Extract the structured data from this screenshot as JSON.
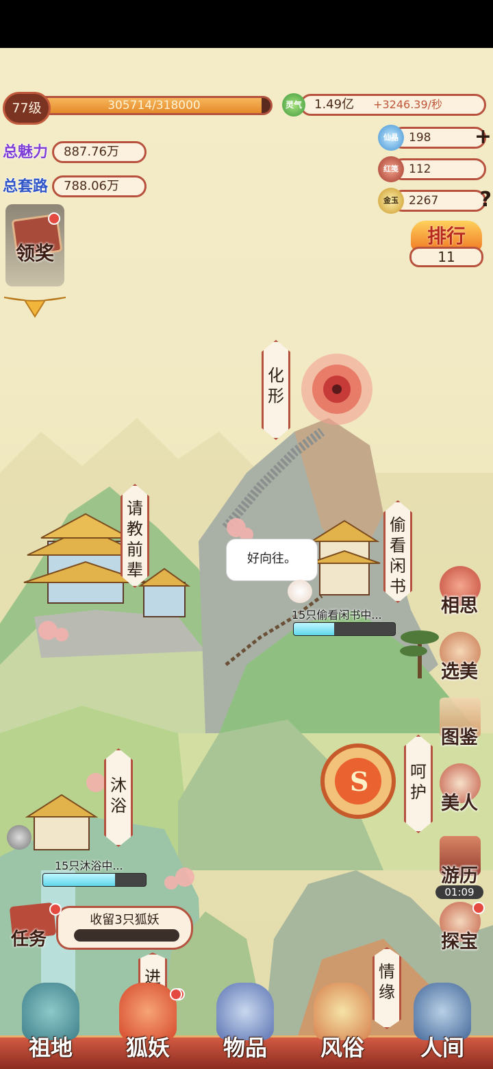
{
  "player": {
    "level": "77级",
    "exp_text": "305714/318000",
    "exp_fraction": 0.961,
    "charm_label": "总魅力",
    "charm_value": "887.76万",
    "trick_label": "总套路",
    "trick_value": "788.06万"
  },
  "resources": {
    "lingqi": {
      "icon_label": "灵气",
      "value": "1.49亿",
      "rate": "+3246.39/秒"
    },
    "xianjing": {
      "icon_label": "仙晶",
      "value": "198",
      "action": "+"
    },
    "hongjian": {
      "icon_label": "红笺",
      "value": "112"
    },
    "jinyu": {
      "icon_label": "金玉",
      "value": "2267",
      "action": "?"
    }
  },
  "ranking": {
    "label": "排行",
    "value": "11"
  },
  "reward": {
    "label": "领奖",
    "has_notification": true
  },
  "map_banners": {
    "huaxing": "化形",
    "qingjiao": "请教前辈",
    "touKan": "偷看闲书",
    "muyu": "沐浴",
    "hehu": "呵护",
    "jin": "进",
    "qingyuan": "情缘"
  },
  "speech_bubble": "好向往。",
  "activities": [
    {
      "text": "15只偷看闲书中...",
      "progress": 0.4
    },
    {
      "text": "15只沐浴中...",
      "progress": 0.7
    }
  ],
  "side_menu": [
    {
      "label": "相思"
    },
    {
      "label": "选美"
    },
    {
      "label": "图鉴"
    },
    {
      "label": "美人"
    },
    {
      "label": "游历",
      "timer": "01:09"
    },
    {
      "label": "探宝",
      "has_notification": true
    }
  ],
  "task": {
    "label": "任务",
    "text": "收留3只狐妖",
    "has_notification": true
  },
  "bottom_nav": [
    {
      "label": "祖地"
    },
    {
      "label": "狐妖",
      "has_notification": true
    },
    {
      "label": "物品"
    },
    {
      "label": "风俗",
      "has_notification": true
    },
    {
      "label": "人间"
    }
  ],
  "colors": {
    "accent_red": "#b4513f",
    "exp_orange": "#e48a2b",
    "charm_purple": "#7f3fd6",
    "progress_cyan": "#5fd7ea"
  }
}
